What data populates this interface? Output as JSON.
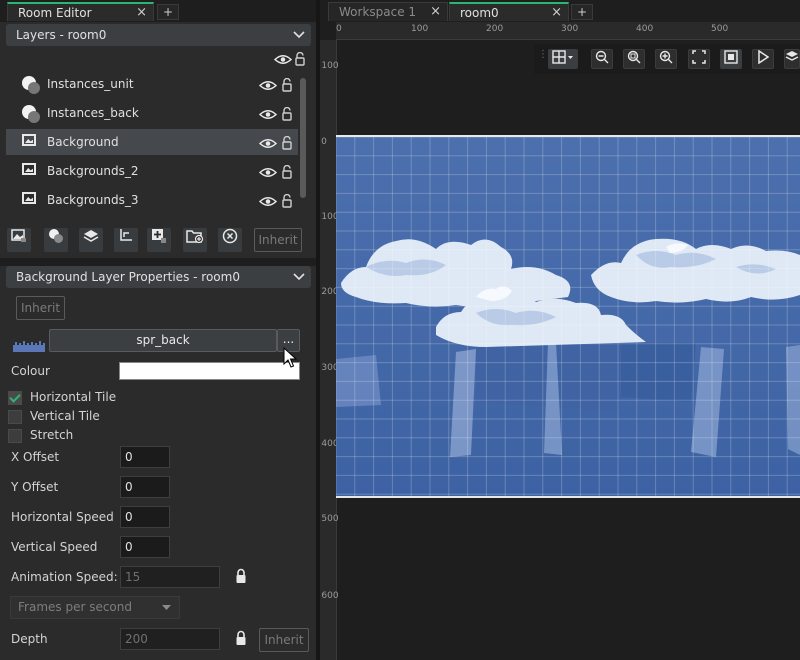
{
  "left_tabs": {
    "room_editor": "Room Editor",
    "close": "×",
    "plus": "+"
  },
  "layers_panel": {
    "title": "Layers - room0",
    "items": [
      {
        "label": "Instances_unit",
        "type": "instance"
      },
      {
        "label": "Instances_back",
        "type": "instance"
      },
      {
        "label": "Background",
        "type": "background",
        "selected": true
      },
      {
        "label": "Backgrounds_2",
        "type": "background"
      },
      {
        "label": "Backgrounds_3",
        "type": "background"
      }
    ],
    "inherit_button": "Inherit"
  },
  "properties": {
    "title": "Background Layer Properties - room0",
    "inherit_top": "Inherit",
    "sprite_name": "spr_back",
    "sprite_menu": "...",
    "colour_label": "Colour",
    "colour_value": "#ffffff",
    "checkboxes": [
      {
        "label": "Horizontal Tile",
        "checked": true
      },
      {
        "label": "Vertical Tile",
        "checked": false
      },
      {
        "label": "Stretch",
        "checked": false
      }
    ],
    "x_offset_label": "X Offset",
    "x_offset": "0",
    "y_offset_label": "Y Offset",
    "y_offset": "0",
    "hspeed_label": "Horizontal Speed",
    "hspeed": "0",
    "vspeed_label": "Vertical Speed",
    "vspeed": "0",
    "anim_label": "Animation Speed:",
    "anim_value": "15",
    "anim_unit": "Frames per second",
    "depth_label": "Depth",
    "depth_value": "200",
    "depth_inherit": "Inherit"
  },
  "right_tabs": {
    "workspace": "Workspace 1",
    "room": "room0",
    "close": "×",
    "plus": "+"
  },
  "ruler": {
    "top": [
      "0",
      "100",
      "200",
      "300",
      "400",
      "500"
    ],
    "left": [
      "100",
      "0",
      "100",
      "200",
      "300",
      "400",
      "500",
      "600"
    ]
  },
  "colors": {
    "accent": "#2bb673",
    "room_bg": "#4064a3",
    "panel": "#2b2b2b"
  }
}
